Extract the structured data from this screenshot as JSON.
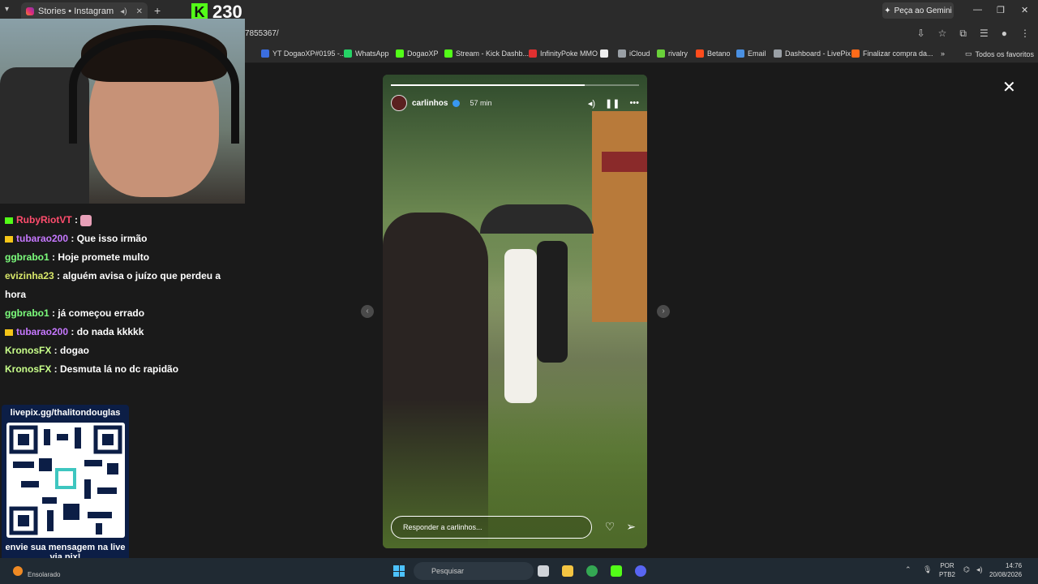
{
  "tab": {
    "title": "Stories • Instagram",
    "new_tab": "+"
  },
  "kick_overlay": {
    "logo": "K",
    "count": "230"
  },
  "gemini_button": "Peça ao Gemini",
  "address": {
    "url": "7855367/"
  },
  "bookmarks": [
    {
      "label": "YT DogaoXP#0195 -...",
      "color": "#3b6ee0"
    },
    {
      "label": "WhatsApp",
      "color": "#25d366"
    },
    {
      "label": "DogaoXP",
      "color": "#53fc18"
    },
    {
      "label": "Stream - Kick Dashb...",
      "color": "#53fc18"
    },
    {
      "label": "InfinityPoke MMO",
      "color": "#e03030"
    },
    {
      "label": "",
      "color": "#eeeeee"
    },
    {
      "label": "iCloud",
      "color": "#9aa0a6"
    },
    {
      "label": "rivalry",
      "color": "#6ad13a"
    },
    {
      "label": "Betano",
      "color": "#ff4c1c"
    },
    {
      "label": "Email",
      "color": "#4a90e2"
    },
    {
      "label": "Dashboard - LivePix",
      "color": "#9aa0a6"
    },
    {
      "label": "Finalizar compra da...",
      "color": "#ff6b1a"
    }
  ],
  "bookmarks_all": "Todos os favoritos",
  "story": {
    "username": "carlinhos",
    "time": "57 min",
    "progress": 0.78,
    "reply_placeholder": "Responder a carlinhos..."
  },
  "chat": [
    {
      "user": "RubyRiotVT",
      "text": "",
      "color": "#ff4d6d",
      "badge": "#53fc18"
    },
    {
      "user": "tubarao200",
      "text": "Que isso irmão",
      "color": "#c678ff",
      "badge": "#f5c518"
    },
    {
      "user": "ggbrabo1",
      "text": "Hoje promete multo",
      "color": "#7dff7d",
      "badge": ""
    },
    {
      "user": "evizinha23",
      "text": "alguém avisa o juízo que perdeu a hora",
      "color": "#d9e86a",
      "badge": ""
    },
    {
      "user": "ggbrabo1",
      "text": "já começou errado",
      "color": "#7dff7d",
      "badge": ""
    },
    {
      "user": "tubarao200",
      "text": "do nada kkkkk",
      "color": "#c678ff",
      "badge": "#f5c518"
    },
    {
      "user": "KronosFX",
      "text": "dogao",
      "color": "#c8ff8a",
      "badge": ""
    },
    {
      "user": "KronosFX",
      "text": "Desmuta lá no dc rapidão",
      "color": "#c8ff8a",
      "badge": ""
    }
  ],
  "qr": {
    "header": "livepix.gg/thalitondouglas",
    "footer": "envie sua mensagem na live via pix!"
  },
  "taskbar": {
    "weather": "Ensolarado",
    "search_placeholder": "Pesquisar",
    "lang_top": "POR",
    "lang_bottom": "PTB2",
    "time": "14:76",
    "date": "20/08/2026"
  }
}
